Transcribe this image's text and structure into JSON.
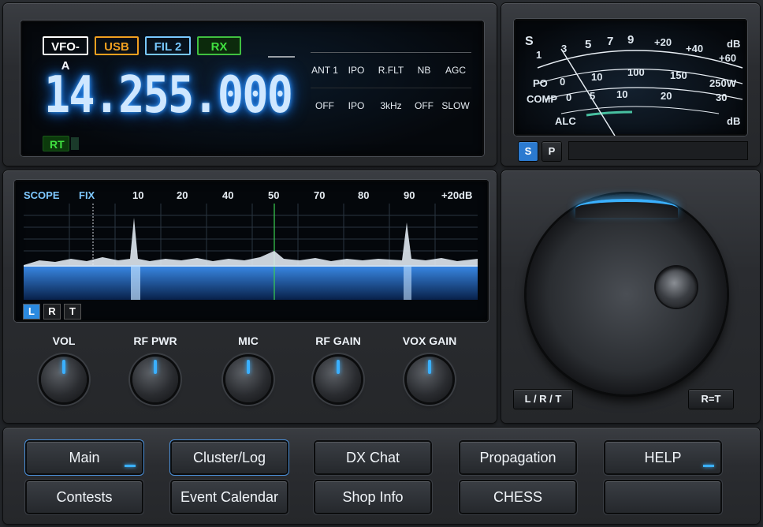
{
  "vfo": {
    "tags": [
      {
        "label": "VFO-A",
        "color": "#ffffff",
        "border": "#ffffff"
      },
      {
        "label": "USB",
        "color": "#f0a020",
        "border": "#f0a020"
      },
      {
        "label": "FIL 2",
        "color": "#78c8ff",
        "border": "#78c8ff"
      },
      {
        "label": "RX",
        "color": "#40e040",
        "border": "#40c040"
      }
    ],
    "frequency": "14.255.000",
    "rt_label": "RT"
  },
  "settings": {
    "headers": [
      "ANT 1",
      "IPO",
      "R.FLT",
      "NB",
      "AGC"
    ],
    "values": [
      "OFF",
      "IPO",
      "3kHz",
      "OFF",
      "SLOW"
    ]
  },
  "meter": {
    "s_label": "S",
    "s_scale": [
      "1",
      "3",
      "5",
      "7",
      "9",
      "+20",
      "+40",
      "+60"
    ],
    "db_label": "dB",
    "po_label": "PO",
    "po_scale": [
      "0",
      "10",
      "100",
      "150",
      "250W"
    ],
    "comp_label": "COMP",
    "comp_scale": [
      "0",
      "5",
      "10",
      "20",
      "30"
    ],
    "alc_label": "ALC",
    "alc_db_label": "dB",
    "buttons": [
      "S",
      "P"
    ]
  },
  "scope": {
    "title": "SCOPE",
    "mode": "FIX",
    "scale": [
      "10",
      "20",
      "40",
      "50",
      "70",
      "80",
      "90",
      "+20dB"
    ],
    "lrt": [
      "L",
      "R",
      "T"
    ],
    "active_lrt": "L"
  },
  "knobs": [
    {
      "label": "VOL"
    },
    {
      "label": "RF PWR"
    },
    {
      "label": "MIC"
    },
    {
      "label": "RF GAIN"
    },
    {
      "label": "VOX GAIN"
    }
  ],
  "dial": {
    "buttons": [
      "L / R / T",
      "R=T"
    ]
  },
  "menu": {
    "row1": [
      {
        "label": "Main",
        "active": true,
        "led": true
      },
      {
        "label": "Cluster/Log",
        "active": true,
        "led": false
      },
      {
        "label": "DX Chat",
        "active": false,
        "led": false
      },
      {
        "label": "Propagation",
        "active": false,
        "led": false
      },
      {
        "label": "HELP",
        "active": false,
        "led": true
      }
    ],
    "row2": [
      {
        "label": "Contests"
      },
      {
        "label": "Event Calendar"
      },
      {
        "label": "Shop Info"
      },
      {
        "label": "CHESS"
      },
      {
        "label": ""
      }
    ]
  }
}
